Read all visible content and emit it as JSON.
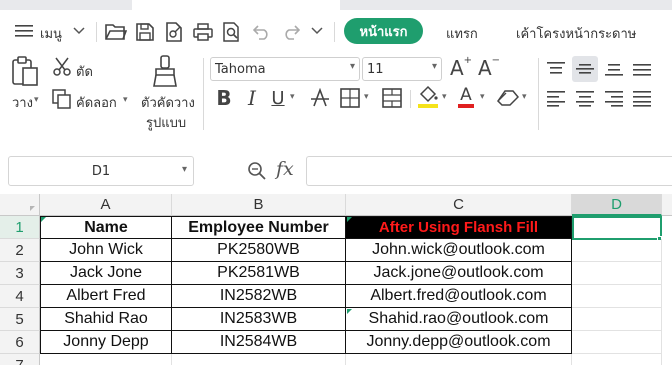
{
  "menubar": {
    "menu_label": "เมนู",
    "tabs": {
      "home": "หน้าแรก",
      "insert": "แทรก",
      "page_layout": "เค้าโครงหน้ากระดาษ"
    }
  },
  "ribbon": {
    "cut_label": "ตัด",
    "paste_label": "วาง",
    "copy_label": "คัดลอก",
    "format_painter_line1": "ตัวคัดวาง",
    "format_painter_line2": "รูปแบบ",
    "font_name": "Tahoma",
    "font_size": "11"
  },
  "formula_bar": {
    "name_box": "D1",
    "fx_label": "fx",
    "formula": ""
  },
  "sheet": {
    "columns": [
      "A",
      "B",
      "C",
      "D"
    ],
    "rows": [
      "1",
      "2",
      "3",
      "4",
      "5",
      "6",
      "7"
    ],
    "selected_cell": "D1",
    "headers": {
      "name": "Name",
      "employee_number": "Employee Number",
      "flash_fill": "After Using Flansh Fill"
    },
    "data": [
      {
        "name": "John Wick",
        "emp": "PK2580WB",
        "email": "John.wick@outlook.com"
      },
      {
        "name": "Jack Jone",
        "emp": "PK2581WB",
        "email": "Jack.jone@outlook.com"
      },
      {
        "name": "Albert Fred",
        "emp": "IN2582WB",
        "email": "Albert.fred@outlook.com"
      },
      {
        "name": "Shahid Rao",
        "emp": "IN2583WB",
        "email": "Shahid.rao@outlook.com"
      },
      {
        "name": "Jonny Depp",
        "emp": "IN2584WB",
        "email": "Jonny.depp@outlook.com"
      }
    ]
  },
  "colors": {
    "accent": "#1f9e6e",
    "header_red_text": "#ff1a1a",
    "header_black_fill": "#000000"
  }
}
